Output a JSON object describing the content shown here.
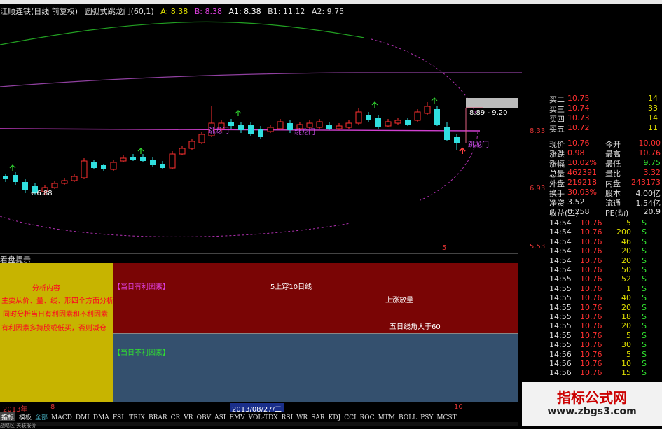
{
  "chart_header": {
    "title": "江顺连铁(日线 前复权)",
    "a": "A: 8.38",
    "b": "B: 8.38",
    "a1": "A1: 8.38",
    "b1": "B1: 11.12",
    "a2": "A2: 9.75",
    "indicator": "圆弧式跳龙门(60,1)"
  },
  "price_labels": {
    "p1": "8.33",
    "p2": "6.93",
    "p3": "5.53"
  },
  "chart_annotations": {
    "low_label": "←6.88",
    "range_label": "8.89 - 9.20",
    "jump1": "跳龙门",
    "jump2": "跳龙门",
    "jump3": "跳龙门",
    "small_mark": "5"
  },
  "hint_panel": {
    "title": "看盘提示",
    "left_title": "分析内容",
    "left_line1": "主要从价、量、线、形四个方面分析",
    "left_line2": "同时分析当日有利因素和不利因素",
    "left_line3": "有利因素多持股或低买，否则减仓",
    "good_header": "【当日有利因素】",
    "good_item1": "5上穿10日线",
    "good_item2": "上涨放量",
    "good_item3": "五日线角大于60",
    "bad_header": "【当日不利因素】"
  },
  "date_bar": {
    "left": "2013年",
    "month": "8",
    "date": "2013/08/27/二",
    "right": "10"
  },
  "tabs": [
    "指标",
    "模板",
    "全部",
    "MACD",
    "DMI",
    "DMA",
    "FSL",
    "TRIX",
    "BRAR",
    "CR",
    "VR",
    "OBV",
    "ASI",
    "EMV",
    "VOL-TDX",
    "RSI",
    "WR",
    "SAR",
    "KDJ",
    "CCI",
    "ROC",
    "MTM",
    "BOLL",
    "PSY",
    "MCST"
  ],
  "bottom_strip": "战略区  关联报价",
  "quote": {
    "asks": [
      {
        "label": "买二",
        "price": "10.75",
        "vol": "14"
      },
      {
        "label": "买三",
        "price": "10.74",
        "vol": "33"
      },
      {
        "label": "买四",
        "price": "10.73",
        "vol": "14"
      },
      {
        "label": "买五",
        "price": "10.72",
        "vol": "11"
      }
    ],
    "stats": [
      {
        "l1": "现价",
        "v1": "10.76",
        "l2": "今开",
        "v2": "10.00"
      },
      {
        "l1": "涨跌",
        "v1": "0.98",
        "l2": "最高",
        "v2": "10.76"
      },
      {
        "l1": "涨幅",
        "v1": "10.02%",
        "l2": "最低",
        "v2": "9.75"
      },
      {
        "l1": "总量",
        "v1": "462391",
        "l2": "量比",
        "v2": "3.32"
      },
      {
        "l1": "外盘",
        "v1": "219218",
        "l2": "内盘",
        "v2": "243173"
      },
      {
        "l1": "换手",
        "v1": "30.03%",
        "l2": "股本",
        "v2": "4.00亿"
      },
      {
        "l1": "净资",
        "v1": "3.52",
        "l2": "流通",
        "v2": "1.54亿"
      },
      {
        "l1": "收益(二)",
        "v1": "0.258",
        "l2": "PE(动)",
        "v2": "20.9"
      }
    ],
    "ticks": [
      {
        "t": "14:54",
        "p": "10.76",
        "v": "5",
        "f": "S"
      },
      {
        "t": "14:54",
        "p": "10.76",
        "v": "200",
        "f": "S"
      },
      {
        "t": "14:54",
        "p": "10.76",
        "v": "46",
        "f": "S"
      },
      {
        "t": "14:54",
        "p": "10.76",
        "v": "20",
        "f": "S"
      },
      {
        "t": "14:54",
        "p": "10.76",
        "v": "20",
        "f": "S"
      },
      {
        "t": "14:54",
        "p": "10.76",
        "v": "50",
        "f": "S"
      },
      {
        "t": "14:55",
        "p": "10.76",
        "v": "52",
        "f": "S"
      },
      {
        "t": "14:55",
        "p": "10.76",
        "v": "1",
        "f": "S"
      },
      {
        "t": "14:55",
        "p": "10.76",
        "v": "40",
        "f": "S"
      },
      {
        "t": "14:55",
        "p": "10.76",
        "v": "20",
        "f": "S"
      },
      {
        "t": "14:55",
        "p": "10.76",
        "v": "18",
        "f": "S"
      },
      {
        "t": "14:55",
        "p": "10.76",
        "v": "20",
        "f": "S"
      },
      {
        "t": "14:55",
        "p": "10.76",
        "v": "5",
        "f": "S"
      },
      {
        "t": "14:55",
        "p": "10.76",
        "v": "30",
        "f": "S"
      },
      {
        "t": "14:56",
        "p": "10.76",
        "v": "5",
        "f": "S"
      },
      {
        "t": "14:56",
        "p": "10.76",
        "v": "10",
        "f": "S"
      },
      {
        "t": "14:56",
        "p": "10.76",
        "v": "15",
        "f": "S"
      }
    ]
  },
  "watermark": {
    "title": "指标公式网",
    "url": "www.zbgs3.com"
  },
  "colors": {
    "up": "#ff3030",
    "down": "#30e0e0",
    "ma_purple": "#d040d0",
    "panel_red": "#7a0505",
    "panel_blue": "#34506e",
    "panel_yellow": "#c7b400"
  }
}
